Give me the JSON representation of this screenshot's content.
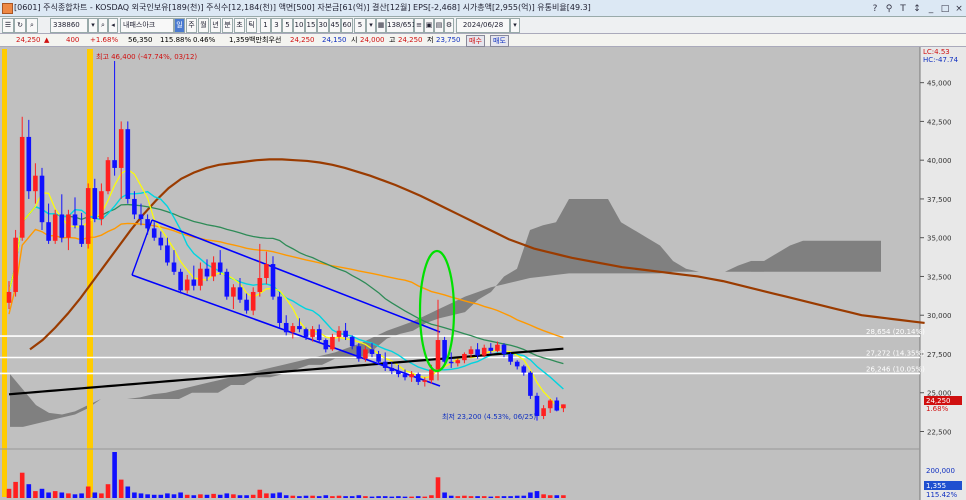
{
  "title": "[0601] 주식종합차트 - KOSDAQ 외국인보유[189(천)] 주식수[12,184(천)] 액면[500] 자본금[61(억)] 결산[12월] EPS[-2,468] 시가총액[2,955(억)] 유통비율[49.3]",
  "window_buttons": [
    "?",
    "⚲",
    "T",
    "↕",
    "_",
    "□",
    "×"
  ],
  "toolbar": {
    "code": "338860",
    "stock_name": "내패스아크",
    "tag": "일",
    "period_buttons": [
      "주",
      "월",
      "년",
      "분",
      "초",
      "틱"
    ],
    "interval_buttons": [
      "1",
      "3",
      "5",
      "10",
      "15",
      "30",
      "45",
      "60"
    ],
    "count_field": "5",
    "range": "138/651",
    "date": "2024/06/28"
  },
  "quote": {
    "price": "24,250",
    "arrow": "▲",
    "change": "400",
    "change_pct": "+1.68%",
    "volume": "56,350",
    "vol_pct": "115.88%",
    "turnover": "0.46%",
    "amount": "1,359백만",
    "best_ask_label": "최우선",
    "best_ask": "24,250",
    "best_bid": "24,150",
    "open_label": "시",
    "open": "24,000",
    "high_label": "고",
    "high": "24,250",
    "low_label": "저",
    "low": "23,750",
    "buy": "매수",
    "sell": "매도"
  },
  "chart_data": {
    "type": "candlestick",
    "y_ticks": [
      "45,000",
      "42,500",
      "40,000",
      "37,500",
      "35,000",
      "32,500",
      "30,000",
      "27,500",
      "25,000",
      "22,500"
    ],
    "ylim": [
      21500,
      47300
    ],
    "vol_ticks": [
      "200,000"
    ],
    "lc_label": "LC:4.53",
    "hc_label": "HC:-47.74",
    "high_annotation": "최고 46,400 (-47.74%, 03/12)",
    "low_annotation": "최저 23,200 (4.53%, 06/25)",
    "levels": [
      {
        "value": 28654,
        "label": "28,654 (20.14%)"
      },
      {
        "value": 27272,
        "label": "27,272 (14.35%)"
      },
      {
        "value": 26246,
        "label": "26,246 (10.05%)"
      }
    ],
    "price_tag": "24,250",
    "price_tag_pct": "1.68%",
    "vol_tag": "1,355",
    "vol_tag_pct": "115.42%",
    "candles": [
      {
        "o": 30800,
        "h": 32200,
        "l": 30400,
        "c": 31500
      },
      {
        "o": 31500,
        "h": 35500,
        "l": 31200,
        "c": 35000
      },
      {
        "o": 35000,
        "h": 42800,
        "l": 34800,
        "c": 41500
      },
      {
        "o": 41500,
        "h": 42600,
        "l": 37500,
        "c": 38000
      },
      {
        "o": 38000,
        "h": 39800,
        "l": 37200,
        "c": 39000
      },
      {
        "o": 39000,
        "h": 39500,
        "l": 35500,
        "c": 36000
      },
      {
        "o": 36000,
        "h": 37200,
        "l": 34600,
        "c": 34800
      },
      {
        "o": 34800,
        "h": 36800,
        "l": 34600,
        "c": 36500
      },
      {
        "o": 36500,
        "h": 37800,
        "l": 34700,
        "c": 35000
      },
      {
        "o": 35000,
        "h": 36800,
        "l": 34200,
        "c": 36500
      },
      {
        "o": 36500,
        "h": 37600,
        "l": 35600,
        "c": 35800
      },
      {
        "o": 35800,
        "h": 36600,
        "l": 34400,
        "c": 34600
      },
      {
        "o": 34600,
        "h": 38500,
        "l": 34300,
        "c": 38200
      },
      {
        "o": 38200,
        "h": 38800,
        "l": 36000,
        "c": 36200
      },
      {
        "o": 36200,
        "h": 38500,
        "l": 35800,
        "c": 38000
      },
      {
        "o": 38000,
        "h": 40200,
        "l": 37800,
        "c": 40000
      },
      {
        "o": 40000,
        "h": 46400,
        "l": 39000,
        "c": 39500
      },
      {
        "o": 39500,
        "h": 42500,
        "l": 37500,
        "c": 42000
      },
      {
        "o": 42000,
        "h": 42500,
        "l": 37200,
        "c": 37500
      },
      {
        "o": 37500,
        "h": 38000,
        "l": 36200,
        "c": 36500
      },
      {
        "o": 36500,
        "h": 37200,
        "l": 35800,
        "c": 36200
      },
      {
        "o": 36200,
        "h": 36500,
        "l": 35200,
        "c": 35600
      },
      {
        "o": 35600,
        "h": 36000,
        "l": 34800,
        "c": 35000
      },
      {
        "o": 35000,
        "h": 35400,
        "l": 34200,
        "c": 34500
      },
      {
        "o": 34500,
        "h": 35000,
        "l": 33200,
        "c": 33400
      },
      {
        "o": 33400,
        "h": 34200,
        "l": 32600,
        "c": 32800
      },
      {
        "o": 32800,
        "h": 33000,
        "l": 31400,
        "c": 31600
      },
      {
        "o": 31600,
        "h": 32600,
        "l": 31400,
        "c": 32300
      },
      {
        "o": 32300,
        "h": 33200,
        "l": 31600,
        "c": 31900
      },
      {
        "o": 31900,
        "h": 33400,
        "l": 31600,
        "c": 33000
      },
      {
        "o": 33000,
        "h": 33600,
        "l": 32200,
        "c": 32500
      },
      {
        "o": 32500,
        "h": 33800,
        "l": 32200,
        "c": 33400
      },
      {
        "o": 33400,
        "h": 34200,
        "l": 32600,
        "c": 32800
      },
      {
        "o": 32800,
        "h": 33000,
        "l": 31000,
        "c": 31200
      },
      {
        "o": 31200,
        "h": 32000,
        "l": 30400,
        "c": 31800
      },
      {
        "o": 31800,
        "h": 32400,
        "l": 30800,
        "c": 31000
      },
      {
        "o": 31000,
        "h": 31400,
        "l": 30100,
        "c": 30300
      },
      {
        "o": 30300,
        "h": 31800,
        "l": 30000,
        "c": 31500
      },
      {
        "o": 31500,
        "h": 34600,
        "l": 31200,
        "c": 32400
      },
      {
        "o": 32400,
        "h": 34100,
        "l": 32000,
        "c": 33300
      },
      {
        "o": 33300,
        "h": 33800,
        "l": 31000,
        "c": 31200
      },
      {
        "o": 31200,
        "h": 31500,
        "l": 29200,
        "c": 29500
      },
      {
        "o": 29500,
        "h": 30000,
        "l": 28700,
        "c": 28900
      },
      {
        "o": 28900,
        "h": 29500,
        "l": 28500,
        "c": 29300
      },
      {
        "o": 29300,
        "h": 29800,
        "l": 28900,
        "c": 29100
      },
      {
        "o": 29100,
        "h": 29200,
        "l": 28400,
        "c": 28600
      },
      {
        "o": 28600,
        "h": 29300,
        "l": 28300,
        "c": 29100
      },
      {
        "o": 29100,
        "h": 29400,
        "l": 28200,
        "c": 28400
      },
      {
        "o": 28400,
        "h": 28500,
        "l": 27600,
        "c": 27800
      },
      {
        "o": 27800,
        "h": 28800,
        "l": 27700,
        "c": 28600
      },
      {
        "o": 28600,
        "h": 29300,
        "l": 28300,
        "c": 29000
      },
      {
        "o": 29000,
        "h": 29500,
        "l": 28400,
        "c": 28600
      },
      {
        "o": 28600,
        "h": 28700,
        "l": 27800,
        "c": 28000
      },
      {
        "o": 28000,
        "h": 28200,
        "l": 27000,
        "c": 27200
      },
      {
        "o": 27200,
        "h": 28000,
        "l": 27000,
        "c": 27800
      },
      {
        "o": 27800,
        "h": 28200,
        "l": 27300,
        "c": 27500
      },
      {
        "o": 27500,
        "h": 27700,
        "l": 26800,
        "c": 27000
      },
      {
        "o": 27000,
        "h": 27600,
        "l": 26400,
        "c": 26600
      },
      {
        "o": 26600,
        "h": 27000,
        "l": 26200,
        "c": 26400
      },
      {
        "o": 26400,
        "h": 26800,
        "l": 26000,
        "c": 26200
      },
      {
        "o": 26200,
        "h": 26500,
        "l": 25800,
        "c": 26000
      },
      {
        "o": 26000,
        "h": 26400,
        "l": 25700,
        "c": 26200
      },
      {
        "o": 26200,
        "h": 26300,
        "l": 25500,
        "c": 25700
      },
      {
        "o": 25700,
        "h": 26000,
        "l": 25400,
        "c": 25800
      },
      {
        "o": 25800,
        "h": 26800,
        "l": 25600,
        "c": 26500
      },
      {
        "o": 26500,
        "h": 31000,
        "l": 25800,
        "c": 28400
      },
      {
        "o": 28400,
        "h": 28600,
        "l": 26800,
        "c": 27000
      },
      {
        "o": 27000,
        "h": 27600,
        "l": 26600,
        "c": 26900
      },
      {
        "o": 26900,
        "h": 27200,
        "l": 26700,
        "c": 27100
      },
      {
        "o": 27100,
        "h": 27600,
        "l": 26900,
        "c": 27500
      },
      {
        "o": 27500,
        "h": 28000,
        "l": 27300,
        "c": 27800
      },
      {
        "o": 27800,
        "h": 28200,
        "l": 27200,
        "c": 27400
      },
      {
        "o": 27400,
        "h": 28100,
        "l": 27300,
        "c": 27900
      },
      {
        "o": 27900,
        "h": 28200,
        "l": 27500,
        "c": 27700
      },
      {
        "o": 27700,
        "h": 28300,
        "l": 27600,
        "c": 28100
      },
      {
        "o": 28100,
        "h": 28200,
        "l": 27300,
        "c": 27500
      },
      {
        "o": 27500,
        "h": 27600,
        "l": 26800,
        "c": 27000
      },
      {
        "o": 27000,
        "h": 27100,
        "l": 26500,
        "c": 26700
      },
      {
        "o": 26700,
        "h": 26800,
        "l": 26100,
        "c": 26300
      },
      {
        "o": 26300,
        "h": 26400,
        "l": 24600,
        "c": 24800
      },
      {
        "o": 24800,
        "h": 25000,
        "l": 23200,
        "c": 23500
      },
      {
        "o": 23500,
        "h": 24200,
        "l": 23300,
        "c": 24000
      },
      {
        "o": 24000,
        "h": 24600,
        "l": 23700,
        "c": 24500
      },
      {
        "o": 24500,
        "h": 24700,
        "l": 23800,
        "c": 23850
      },
      {
        "o": 24000,
        "h": 24250,
        "l": 23750,
        "c": 24250
      }
    ],
    "volume_rel": [
      0.2,
      0.35,
      0.55,
      0.3,
      0.15,
      0.2,
      0.12,
      0.15,
      0.12,
      0.1,
      0.08,
      0.1,
      0.25,
      0.12,
      0.1,
      0.3,
      1.0,
      0.4,
      0.25,
      0.12,
      0.1,
      0.08,
      0.07,
      0.07,
      0.1,
      0.08,
      0.12,
      0.07,
      0.06,
      0.08,
      0.07,
      0.09,
      0.07,
      0.1,
      0.08,
      0.06,
      0.06,
      0.07,
      0.18,
      0.1,
      0.1,
      0.12,
      0.06,
      0.05,
      0.04,
      0.05,
      0.05,
      0.04,
      0.06,
      0.04,
      0.05,
      0.04,
      0.04,
      0.06,
      0.04,
      0.03,
      0.04,
      0.04,
      0.03,
      0.04,
      0.03,
      0.03,
      0.04,
      0.03,
      0.06,
      0.45,
      0.12,
      0.05,
      0.04,
      0.05,
      0.04,
      0.04,
      0.04,
      0.03,
      0.04,
      0.04,
      0.04,
      0.05,
      0.05,
      0.12,
      0.15,
      0.08,
      0.06,
      0.06,
      0.06
    ],
    "ma_long": [
      27800,
      28400,
      29200,
      30100,
      31100,
      32200,
      33300,
      34400,
      35500,
      36500,
      37400,
      38200,
      38800,
      39200,
      39500,
      39700,
      39800,
      39900,
      40000,
      40050,
      40050,
      40000,
      39950,
      39850,
      39700,
      39500,
      39250,
      39000,
      38700,
      38400,
      38050,
      37700,
      37300,
      36900,
      36500,
      36100,
      35700,
      35300,
      34900,
      34600,
      34300,
      34100,
      33900,
      33700,
      33550,
      33400,
      33250,
      33100,
      33000,
      32900,
      32800,
      32700,
      32600,
      32500,
      32350,
      32200,
      32000,
      31800,
      31600,
      31400,
      31200,
      31000,
      30800,
      30600,
      30400,
      30200,
      30000,
      29900,
      29800,
      29700,
      29600,
      29500
    ],
    "ichimoku_top": [
      22800,
      22800,
      23000,
      23200,
      23400,
      23600,
      24000,
      24600,
      24600,
      24600,
      24600,
      24600,
      24600,
      24600,
      25000,
      25000,
      25000,
      25500,
      25500,
      26000,
      26000,
      26200,
      26500,
      26800,
      26800,
      27200,
      27200,
      27200,
      27800,
      28500,
      28800,
      29000,
      29500,
      29800,
      30000,
      30200,
      31000,
      31500,
      32500,
      33000,
      35500,
      35800,
      36000,
      37500,
      37500,
      37500,
      37500,
      36000,
      35500,
      35000,
      34500,
      33500,
      33000,
      32800,
      32800,
      32800,
      33200,
      33500,
      33500,
      34000,
      34500,
      34800,
      34800,
      34800,
      34800,
      34800,
      34800,
      34800
    ],
    "ichimoku_bot": [
      26200,
      25200,
      24200,
      23700,
      23600,
      23800,
      24200,
      24600,
      24600,
      24600,
      24700,
      24900,
      25000,
      25200,
      25400,
      25600,
      25800,
      26000,
      26200,
      26400,
      26600,
      26800,
      27000,
      27200,
      27400,
      27600,
      27900,
      28200,
      28600,
      29000,
      29300,
      29600,
      30000,
      30400,
      30800,
      31200,
      31500,
      31800,
      32000,
      32200,
      32400,
      32500,
      32600,
      32700,
      32700,
      32700,
      32700,
      32700,
      32700,
      32700,
      32700,
      32800,
      32800,
      32800,
      32800,
      32800,
      32800,
      32800,
      32800,
      32800,
      32800,
      32800,
      32800,
      32800,
      32800,
      32800,
      32800,
      32800
    ]
  }
}
